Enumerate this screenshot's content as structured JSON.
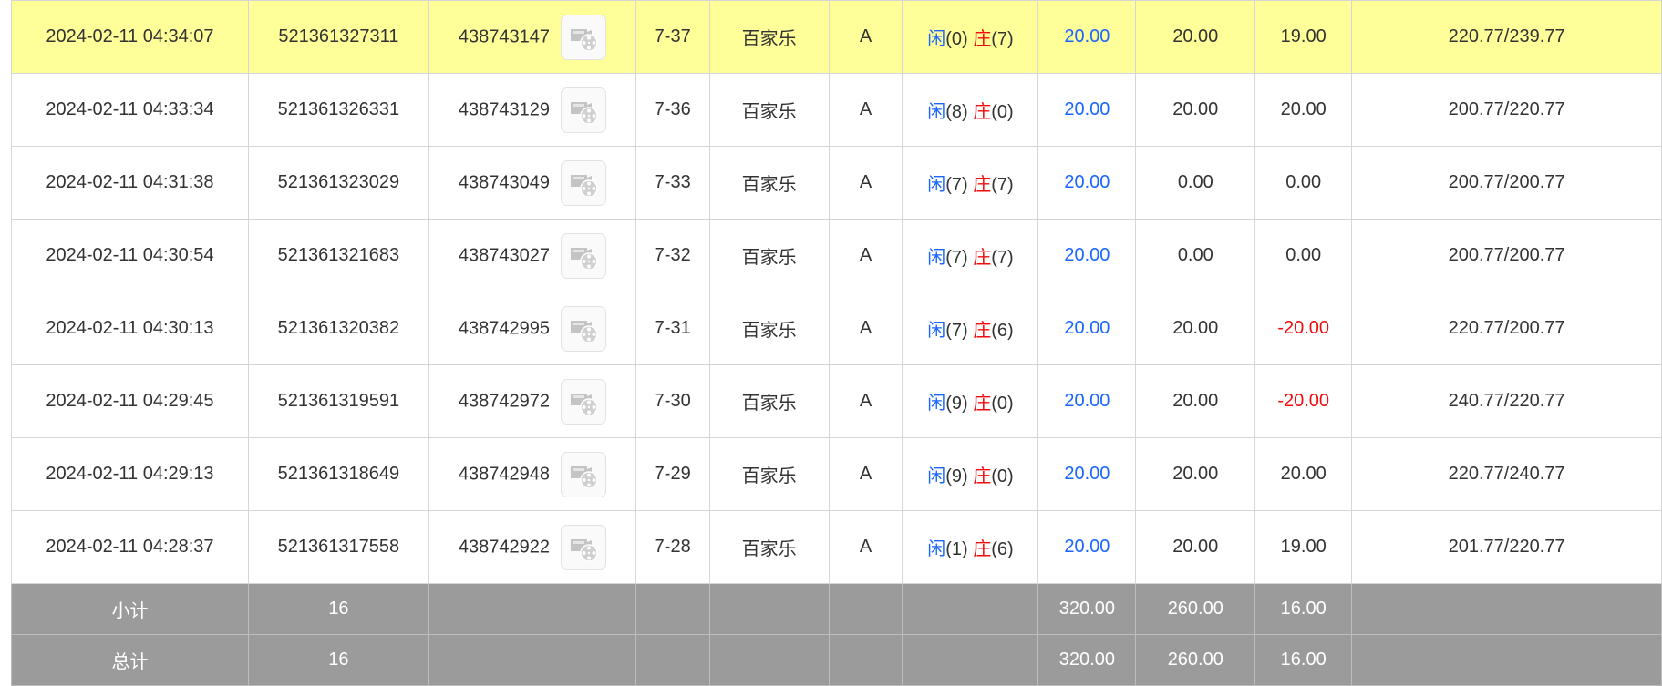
{
  "colors": {
    "highlight": "#ffff99",
    "player": "#1a66ff",
    "banker": "#f20c0c",
    "summary_bg": "#9b9b9b"
  },
  "rows": [
    {
      "time": "2024-02-11 04:34:07",
      "bet_id": "521361327311",
      "round_id": "438743147",
      "shoe": "7-37",
      "game": "百家乐",
      "table": "A",
      "player_label": "闲",
      "player_score": "(0)",
      "banker_label": "庄",
      "banker_score": "(7)",
      "bet": "20.00",
      "valid": "20.00",
      "win": "19.00",
      "balance": "220.77/239.77",
      "highlight": true
    },
    {
      "time": "2024-02-11 04:33:34",
      "bet_id": "521361326331",
      "round_id": "438743129",
      "shoe": "7-36",
      "game": "百家乐",
      "table": "A",
      "player_label": "闲",
      "player_score": "(8)",
      "banker_label": "庄",
      "banker_score": "(0)",
      "bet": "20.00",
      "valid": "20.00",
      "win": "20.00",
      "balance": "200.77/220.77"
    },
    {
      "time": "2024-02-11 04:31:38",
      "bet_id": "521361323029",
      "round_id": "438743049",
      "shoe": "7-33",
      "game": "百家乐",
      "table": "A",
      "player_label": "闲",
      "player_score": "(7)",
      "banker_label": "庄",
      "banker_score": "(7)",
      "bet": "20.00",
      "valid": "0.00",
      "win": "0.00",
      "balance": "200.77/200.77"
    },
    {
      "time": "2024-02-11 04:30:54",
      "bet_id": "521361321683",
      "round_id": "438743027",
      "shoe": "7-32",
      "game": "百家乐",
      "table": "A",
      "player_label": "闲",
      "player_score": "(7)",
      "banker_label": "庄",
      "banker_score": "(7)",
      "bet": "20.00",
      "valid": "0.00",
      "win": "0.00",
      "balance": "200.77/200.77"
    },
    {
      "time": "2024-02-11 04:30:13",
      "bet_id": "521361320382",
      "round_id": "438742995",
      "shoe": "7-31",
      "game": "百家乐",
      "table": "A",
      "player_label": "闲",
      "player_score": "(7)",
      "banker_label": "庄",
      "banker_score": "(6)",
      "bet": "20.00",
      "valid": "20.00",
      "win": "-20.00",
      "balance": "220.77/200.77"
    },
    {
      "time": "2024-02-11 04:29:45",
      "bet_id": "521361319591",
      "round_id": "438742972",
      "shoe": "7-30",
      "game": "百家乐",
      "table": "A",
      "player_label": "闲",
      "player_score": "(9)",
      "banker_label": "庄",
      "banker_score": "(0)",
      "bet": "20.00",
      "valid": "20.00",
      "win": "-20.00",
      "balance": "240.77/220.77"
    },
    {
      "time": "2024-02-11 04:29:13",
      "bet_id": "521361318649",
      "round_id": "438742948",
      "shoe": "7-29",
      "game": "百家乐",
      "table": "A",
      "player_label": "闲",
      "player_score": "(9)",
      "banker_label": "庄",
      "banker_score": "(0)",
      "bet": "20.00",
      "valid": "20.00",
      "win": "20.00",
      "balance": "220.77/240.77"
    },
    {
      "time": "2024-02-11 04:28:37",
      "bet_id": "521361317558",
      "round_id": "438742922",
      "shoe": "7-28",
      "game": "百家乐",
      "table": "A",
      "player_label": "闲",
      "player_score": "(1)",
      "banker_label": "庄",
      "banker_score": "(6)",
      "bet": "20.00",
      "valid": "20.00",
      "win": "19.00",
      "balance": "201.77/220.77"
    }
  ],
  "subtotal": {
    "label": "小计",
    "count": "16",
    "bet": "320.00",
    "valid": "260.00",
    "win": "16.00"
  },
  "total": {
    "label": "总计",
    "count": "16",
    "bet": "320.00",
    "valid": "260.00",
    "win": "16.00"
  }
}
